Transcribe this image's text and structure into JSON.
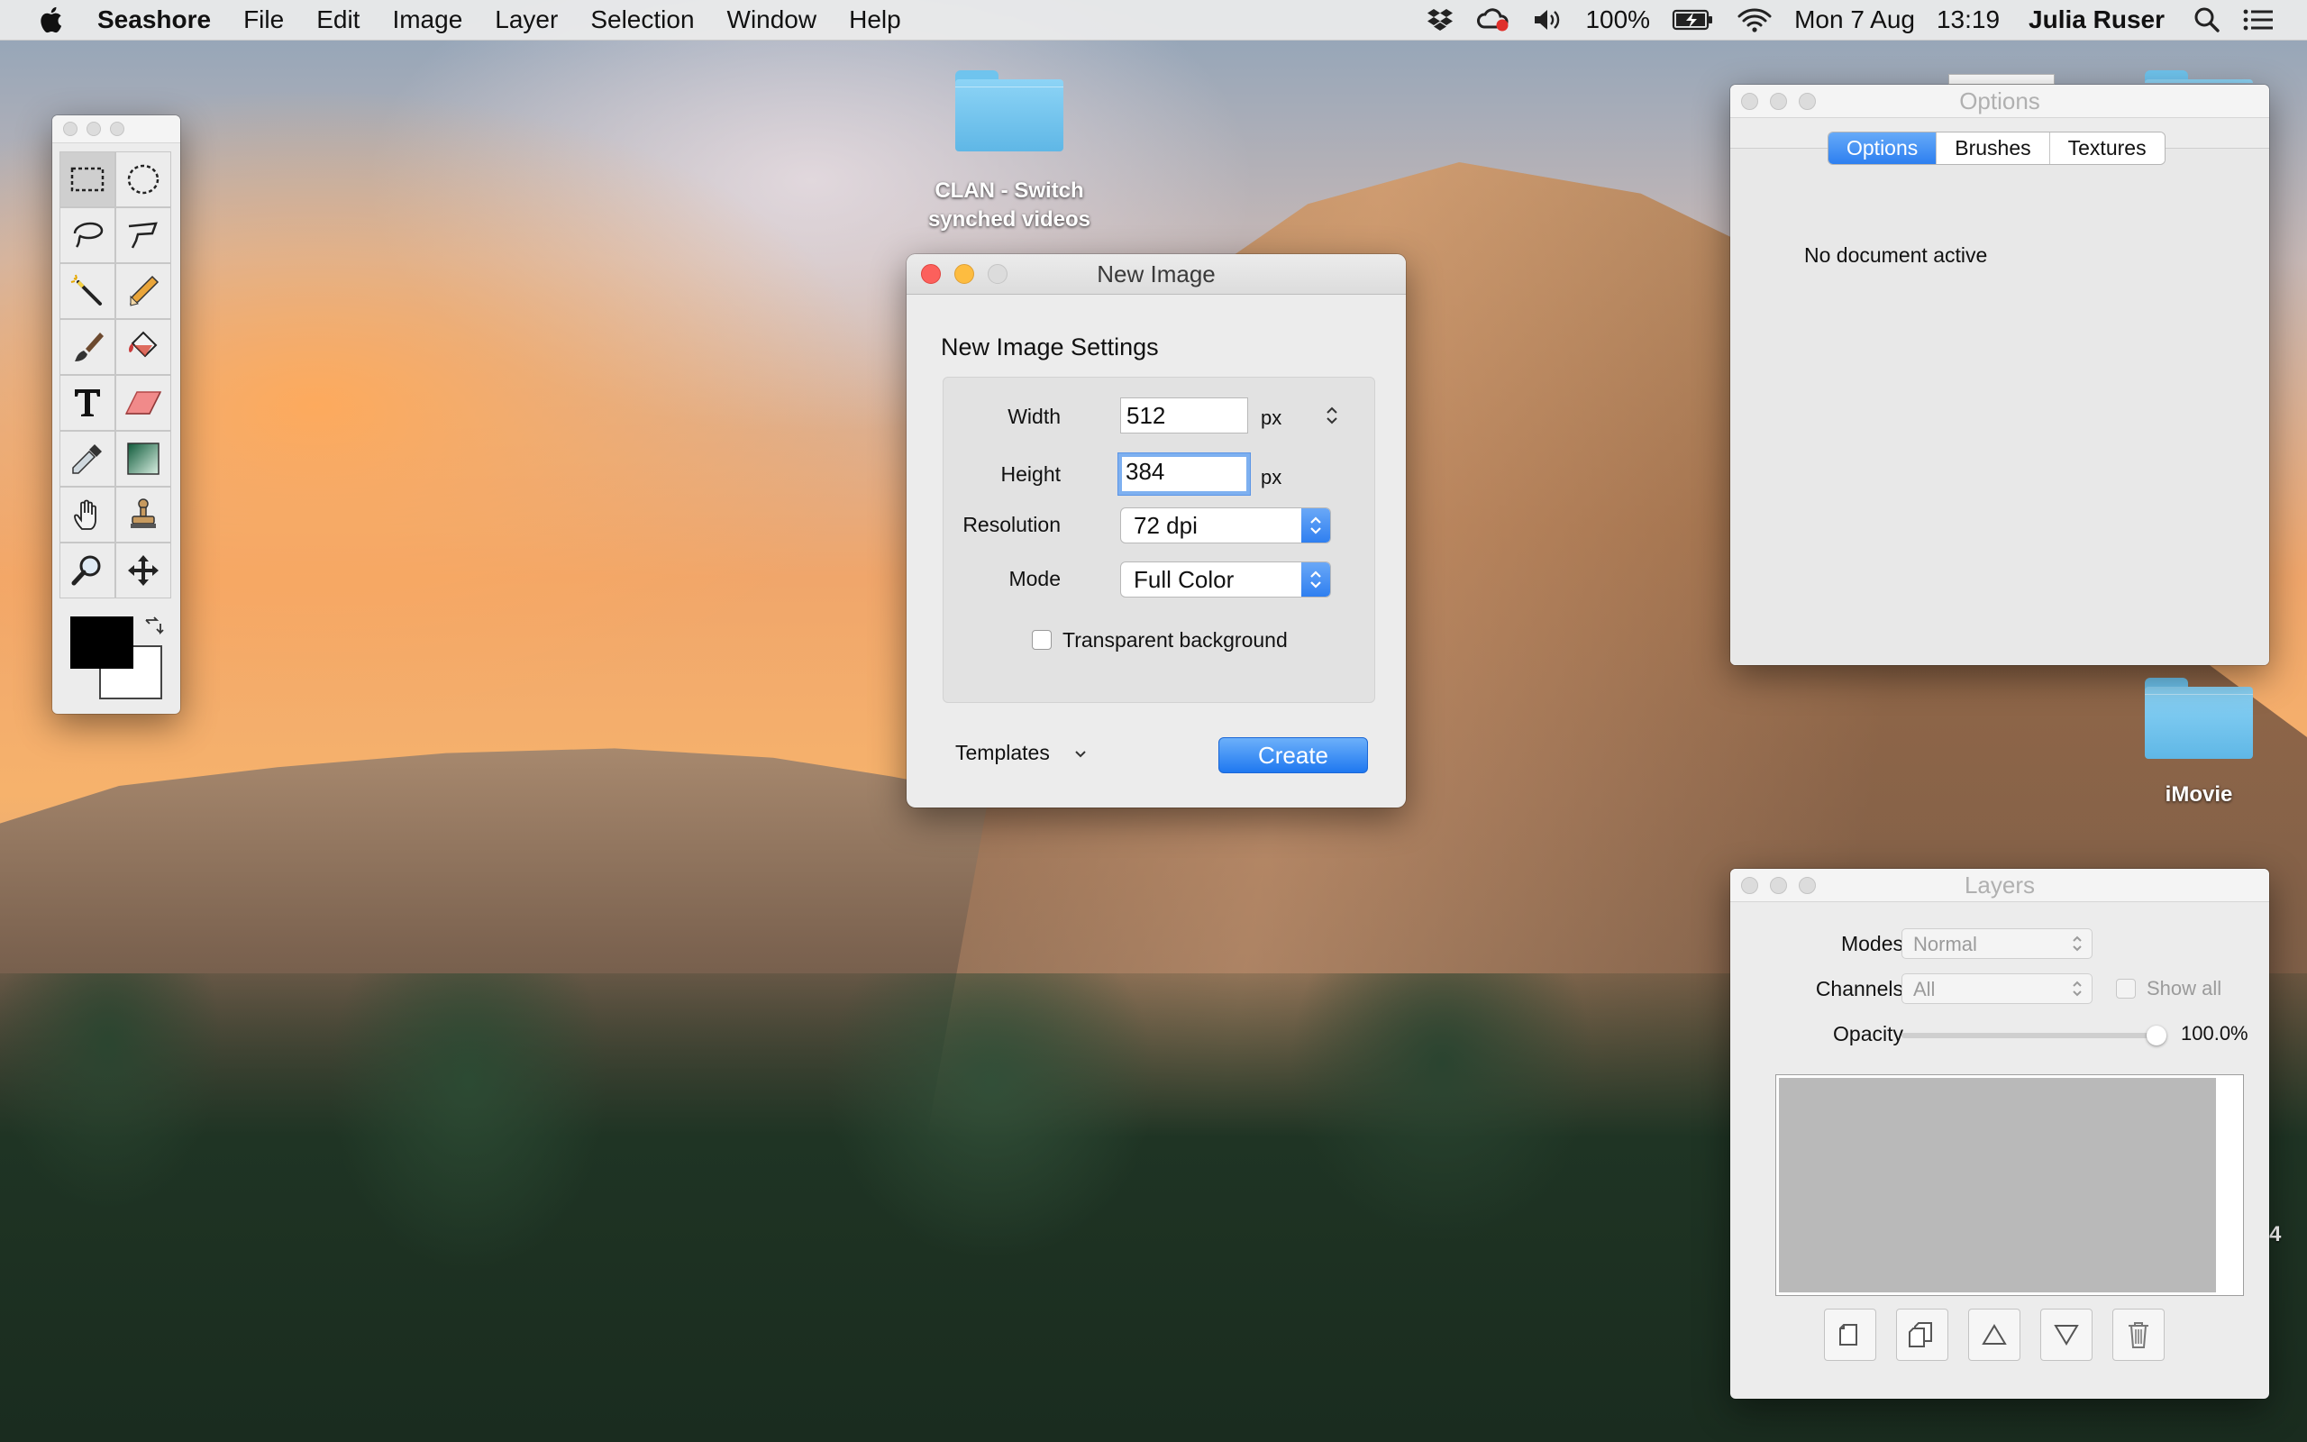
{
  "menubar": {
    "app_name": "Seashore",
    "items": [
      "File",
      "Edit",
      "Image",
      "Layer",
      "Selection",
      "Window",
      "Help"
    ],
    "battery": "100%",
    "date": "Mon 7 Aug",
    "time": "13:19",
    "user": "Julia Ruser"
  },
  "desktop": {
    "icons": [
      {
        "label_line1": "CLAN - Switch",
        "label_line2": "synched videos"
      },
      {
        "label_line1": "iMovie"
      }
    ],
    "edge_text": "4"
  },
  "new_image": {
    "title": "New Image",
    "section_title": "New Image Settings",
    "width_label": "Width",
    "width_value": "512",
    "width_unit": "px",
    "height_label": "Height",
    "height_value": "384",
    "height_unit": "px",
    "resolution_label": "Resolution",
    "resolution_value": "72 dpi",
    "mode_label": "Mode",
    "mode_value": "Full Color",
    "transparent_label": "Transparent background",
    "transparent_checked": false,
    "templates_label": "Templates",
    "create_label": "Create"
  },
  "options": {
    "title": "Options",
    "tabs": [
      "Options",
      "Brushes",
      "Textures"
    ],
    "active_tab": "Options",
    "message": "No document active"
  },
  "layers": {
    "title": "Layers",
    "modes_label": "Modes",
    "modes_value": "Normal",
    "channels_label": "Channels",
    "channels_value": "All",
    "show_all_label": "Show all",
    "opacity_label": "Opacity",
    "opacity_value": "100.0%"
  },
  "toolbox": {
    "tools": [
      "rect-select",
      "ellipse-select",
      "lasso",
      "polygon-lasso",
      "magic-wand",
      "pencil",
      "brush",
      "bucket",
      "text",
      "eraser",
      "eyedropper",
      "gradient",
      "smudge",
      "clone-stamp",
      "zoom",
      "move"
    ],
    "selected_tool": "rect-select",
    "foreground_color": "#000000",
    "background_color": "#ffffff"
  },
  "colors": {
    "accent": "#2f7ff0",
    "close": "#fc605c",
    "minimize": "#fdbc40"
  }
}
